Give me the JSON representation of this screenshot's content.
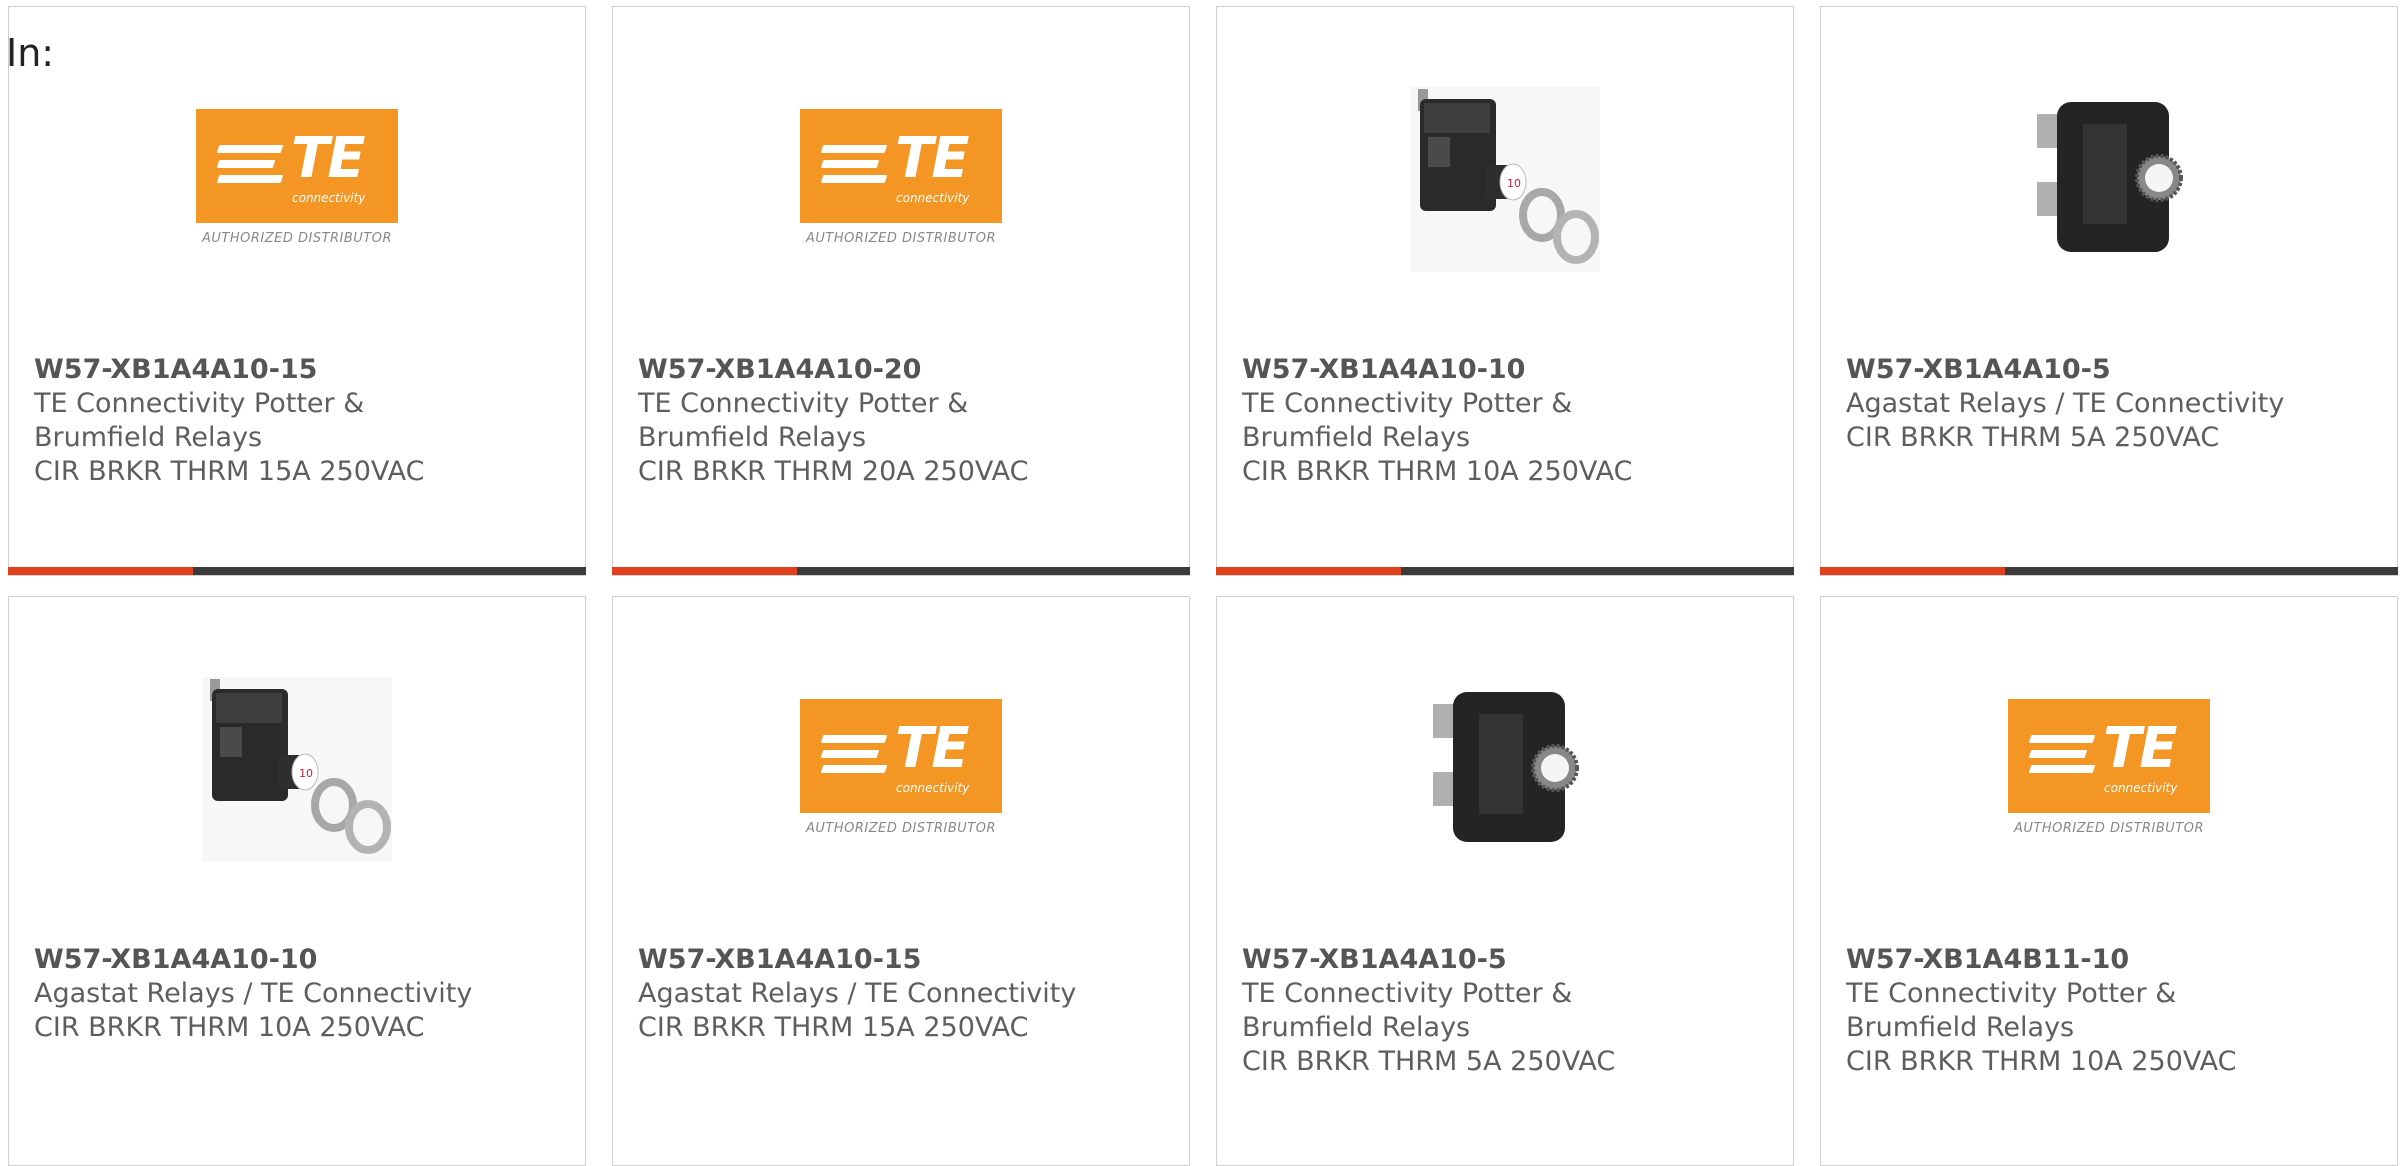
{
  "header": {
    "in_label": "In:"
  },
  "colors": {
    "accent": "#e0401c",
    "bar": "#3c3c3c",
    "te_orange": "#f49623"
  },
  "te_logo": {
    "letters": "TE",
    "subtext": "connectivity",
    "authorized": "AUTHORIZED DISTRIBUTOR"
  },
  "products": [
    {
      "part": "W57-XB1A4A10-15",
      "manufacturer": "TE Connectivity Potter & Brumfield Relays",
      "description": "CIR BRKR THRM 15A 250VAC",
      "image": "te-logo"
    },
    {
      "part": "W57-XB1A4A10-20",
      "manufacturer": "TE Connectivity Potter & Brumfield Relays",
      "description": "CIR BRKR THRM 20A 250VAC",
      "image": "te-logo"
    },
    {
      "part": "W57-XB1A4A10-10",
      "manufacturer": "TE Connectivity Potter & Brumfield Relays",
      "description": "CIR BRKR THRM 10A 250VAC",
      "image": "breaker-side-with-nuts"
    },
    {
      "part": "W57-XB1A4A10-5",
      "manufacturer": "Agastat Relays / TE Connectivity",
      "description": "CIR BRKR THRM 5A 250VAC",
      "image": "breaker-front"
    },
    {
      "part": "W57-XB1A4A10-10",
      "manufacturer": "Agastat Relays / TE Connectivity",
      "description": "CIR BRKR THRM 10A 250VAC",
      "image": "breaker-side-with-nuts"
    },
    {
      "part": "W57-XB1A4A10-15",
      "manufacturer": "Agastat Relays / TE Connectivity",
      "description": "CIR BRKR THRM 15A 250VAC",
      "image": "te-logo"
    },
    {
      "part": "W57-XB1A4A10-5",
      "manufacturer": "TE Connectivity Potter & Brumfield Relays",
      "description": "CIR BRKR THRM 5A 250VAC",
      "image": "breaker-front"
    },
    {
      "part": "W57-XB1A4B11-10",
      "manufacturer": "TE Connectivity Potter & Brumfield Relays",
      "description": "CIR BRKR THRM 10A 250VAC",
      "image": "te-logo"
    }
  ]
}
